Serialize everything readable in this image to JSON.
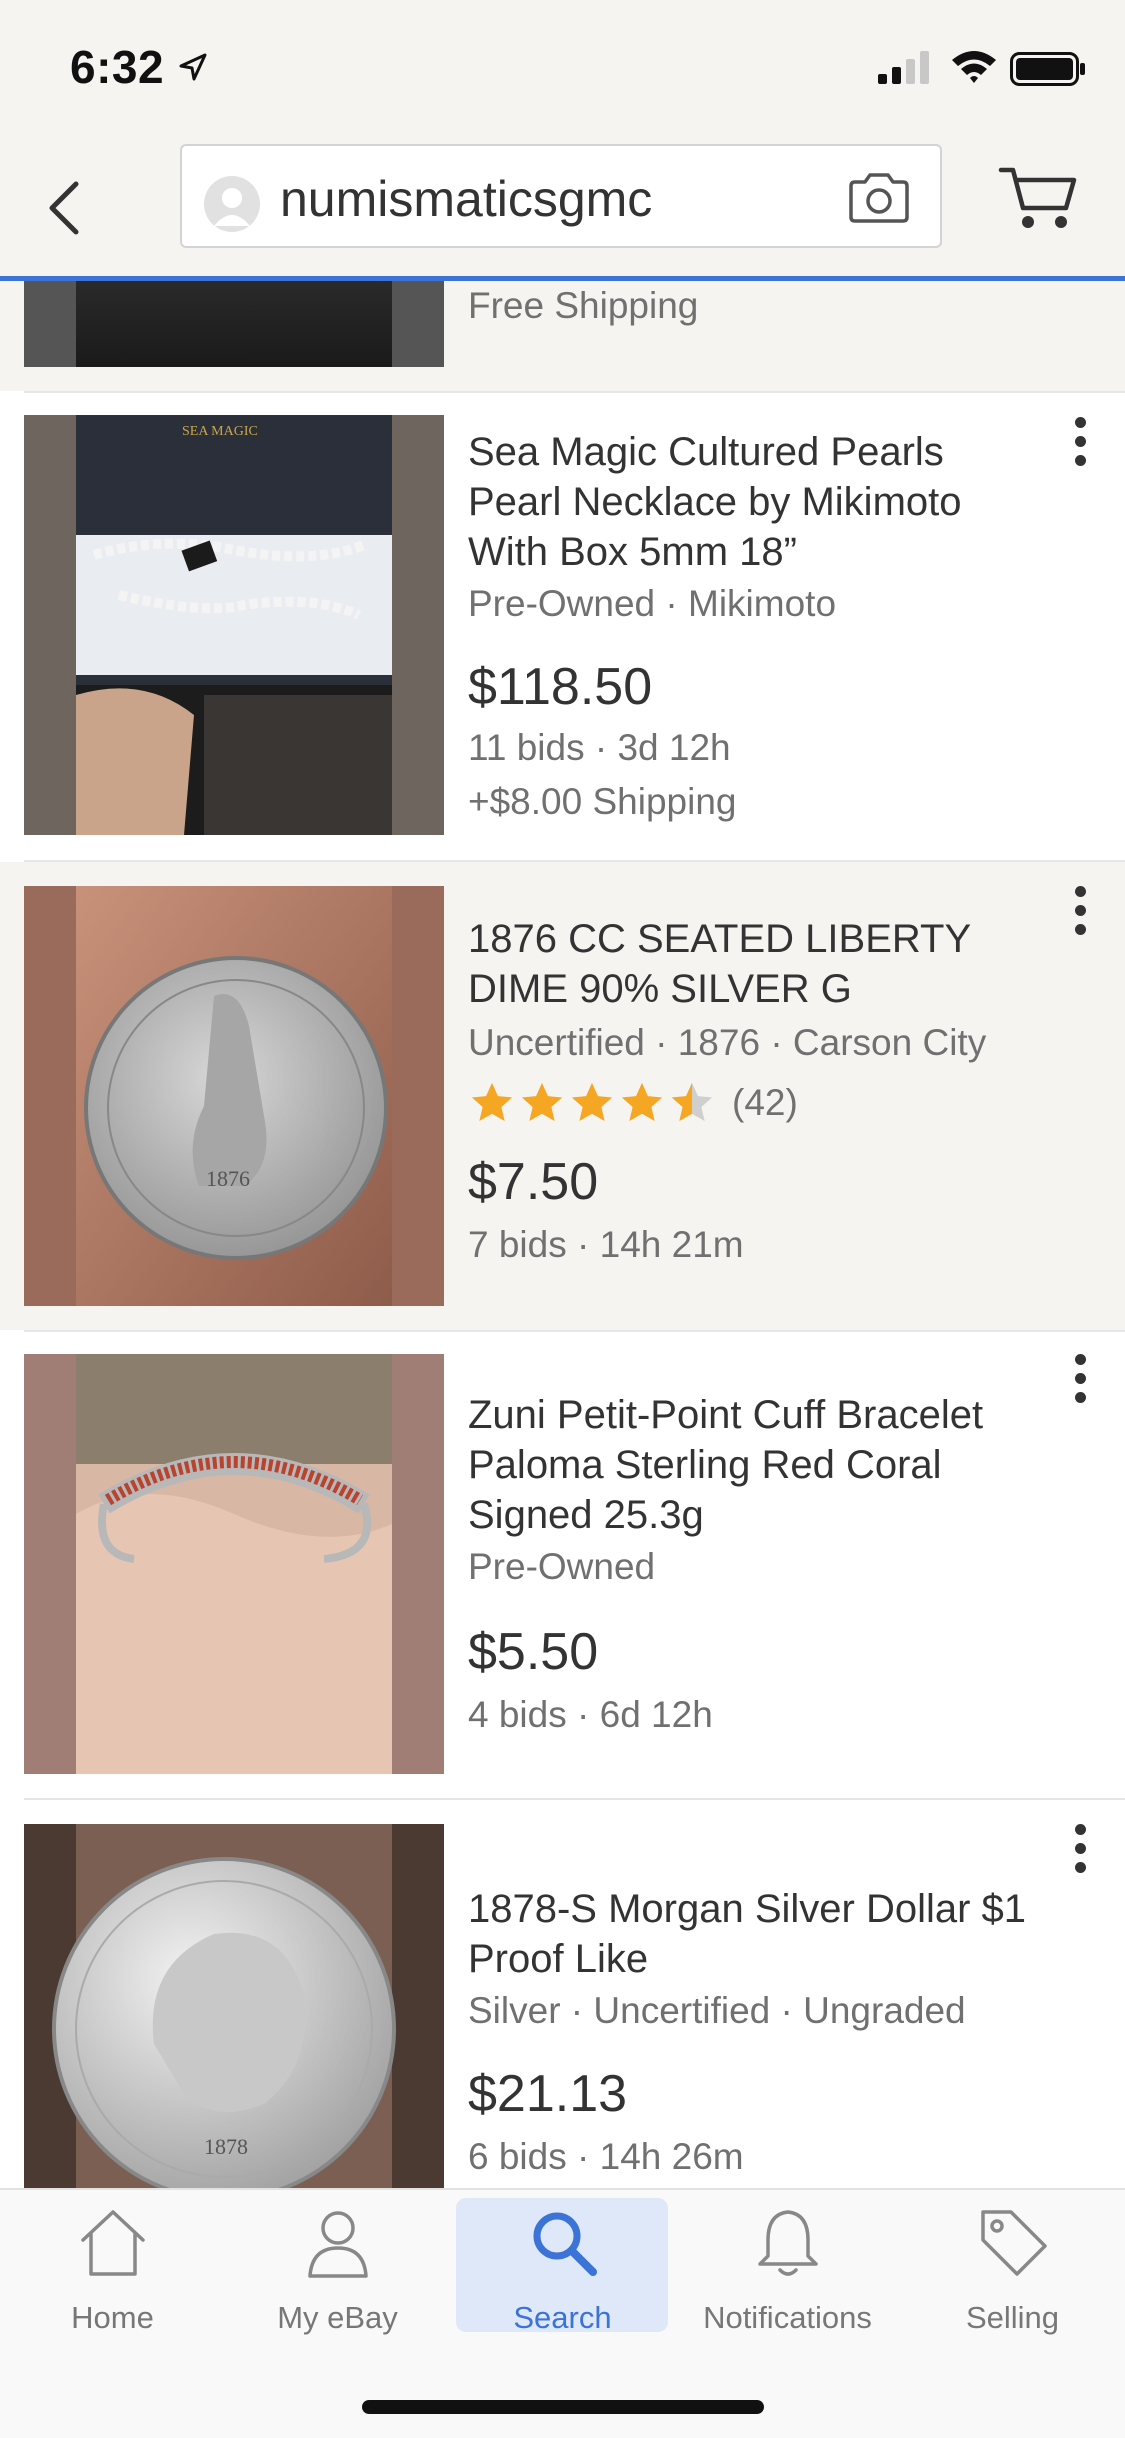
{
  "status": {
    "time": "6:32"
  },
  "header": {
    "search_text": "numismaticsgmc"
  },
  "partial_listing": {
    "shipping": "Free Shipping"
  },
  "listings": [
    {
      "title": "Sea Magic Cultured Pearls Pearl Necklace by Mikimoto With Box 5mm 18”",
      "subtitle": "Pre-Owned · Mikimoto",
      "price": "$118.50",
      "bids": "11 bids · 3d 12h",
      "shipping": "+$8.00 Shipping",
      "image_label": "SEA MAGIC"
    },
    {
      "title": "1876 CC SEATED LIBERTY DIME 90% SILVER G",
      "subtitle": "Uncertified · 1876 · Carson City",
      "rating": 4.5,
      "rating_count": "(42)",
      "price": "$7.50",
      "bids": "7 bids · 14h 21m",
      "image_label": "1876"
    },
    {
      "title": "Zuni Petit-Point Cuff Bracelet Paloma Sterling Red Coral Signed 25.3g",
      "subtitle": "Pre-Owned",
      "price": "$5.50",
      "bids": "4 bids · 6d 12h"
    },
    {
      "title": "1878-S Morgan Silver Dollar $1 Proof Like",
      "subtitle": "Silver · Uncertified · Ungraded",
      "price": "$21.13",
      "bids": "6 bids · 14h 26m",
      "image_label": "1878"
    }
  ],
  "nav": {
    "items": [
      {
        "label": "Home",
        "icon": "home-icon"
      },
      {
        "label": "My eBay",
        "icon": "user-icon"
      },
      {
        "label": "Search",
        "icon": "search-icon",
        "active": true
      },
      {
        "label": "Notifications",
        "icon": "bell-icon"
      },
      {
        "label": "Selling",
        "icon": "tag-icon"
      }
    ]
  },
  "colors": {
    "accent": "#3b73d6",
    "star": "#f5a623",
    "grey_bg": "#f5f4f1"
  }
}
